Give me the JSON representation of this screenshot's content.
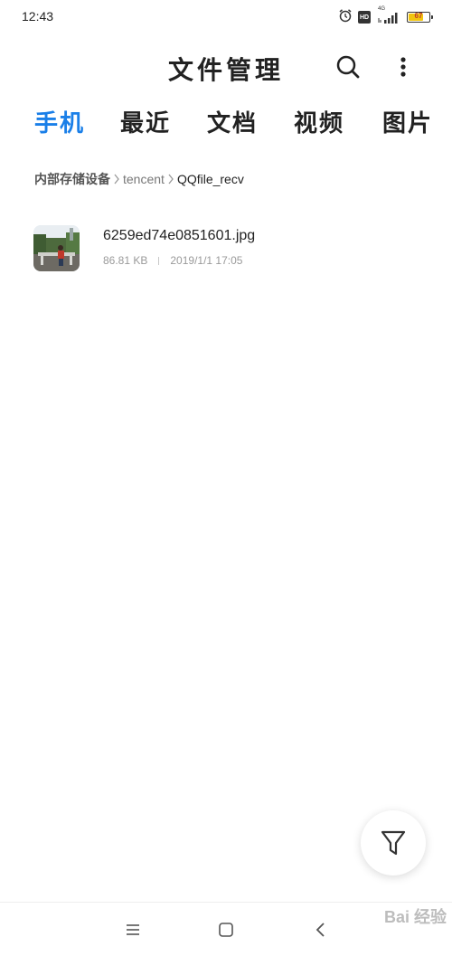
{
  "status_bar": {
    "time": "12:43",
    "hd_label": "HD",
    "network_label": "4G",
    "battery_level": "67"
  },
  "header": {
    "title": "文件管理",
    "search_icon": "search-icon",
    "more_icon": "more-vertical-icon"
  },
  "tabs": [
    {
      "label": "手机",
      "active": true
    },
    {
      "label": "最近",
      "active": false
    },
    {
      "label": "文档",
      "active": false
    },
    {
      "label": "视频",
      "active": false
    },
    {
      "label": "图片",
      "active": false
    }
  ],
  "breadcrumb": {
    "root": "内部存储设备",
    "folder": "tencent",
    "current": "QQfile_recv"
  },
  "files": [
    {
      "name": "6259ed74e0851601.jpg",
      "size": "86.81 KB",
      "date": "2019/1/1 17:05"
    }
  ],
  "fab_icon": "filter-icon",
  "nav_bar": {
    "menu_icon": "menu-icon",
    "home_icon": "home-square-icon",
    "back_icon": "back-chevron-icon"
  },
  "watermark": "Bai 经验",
  "colors": {
    "accent": "#1a7fe8",
    "text_primary": "#222222",
    "text_secondary": "#9a9a9a"
  }
}
